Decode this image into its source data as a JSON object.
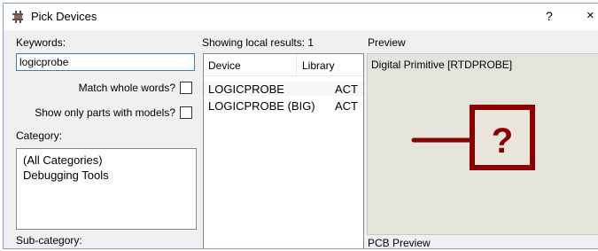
{
  "window": {
    "title": "Pick Devices",
    "help": "?",
    "close": "×"
  },
  "search": {
    "keywords_label": "Keywords:",
    "keywords_value": "logicprobe",
    "match_whole_words": "Match whole words?",
    "match_whole_words_checked": false,
    "parts_with_models": "Show only parts with models?",
    "parts_with_models_checked": false,
    "category_label": "Category:",
    "categories": [
      "(All Categories)",
      "Debugging Tools"
    ],
    "subcategory_label": "Sub-category:"
  },
  "results": {
    "status": "Showing local results: 1",
    "col_device": "Device",
    "col_library": "Library",
    "rows": [
      {
        "device": "LOGICPROBE",
        "library": "ACT"
      },
      {
        "device": "LOGICPROBE (BIG)",
        "library": "ACT"
      }
    ]
  },
  "preview": {
    "label": "Preview",
    "caption": "Digital Primitive [RTDPROBE]",
    "symbol_text": "?",
    "symbol_color": "#8b0000",
    "symbol_fill": "#eae6dc",
    "pcb_label": "PCB Preview"
  }
}
